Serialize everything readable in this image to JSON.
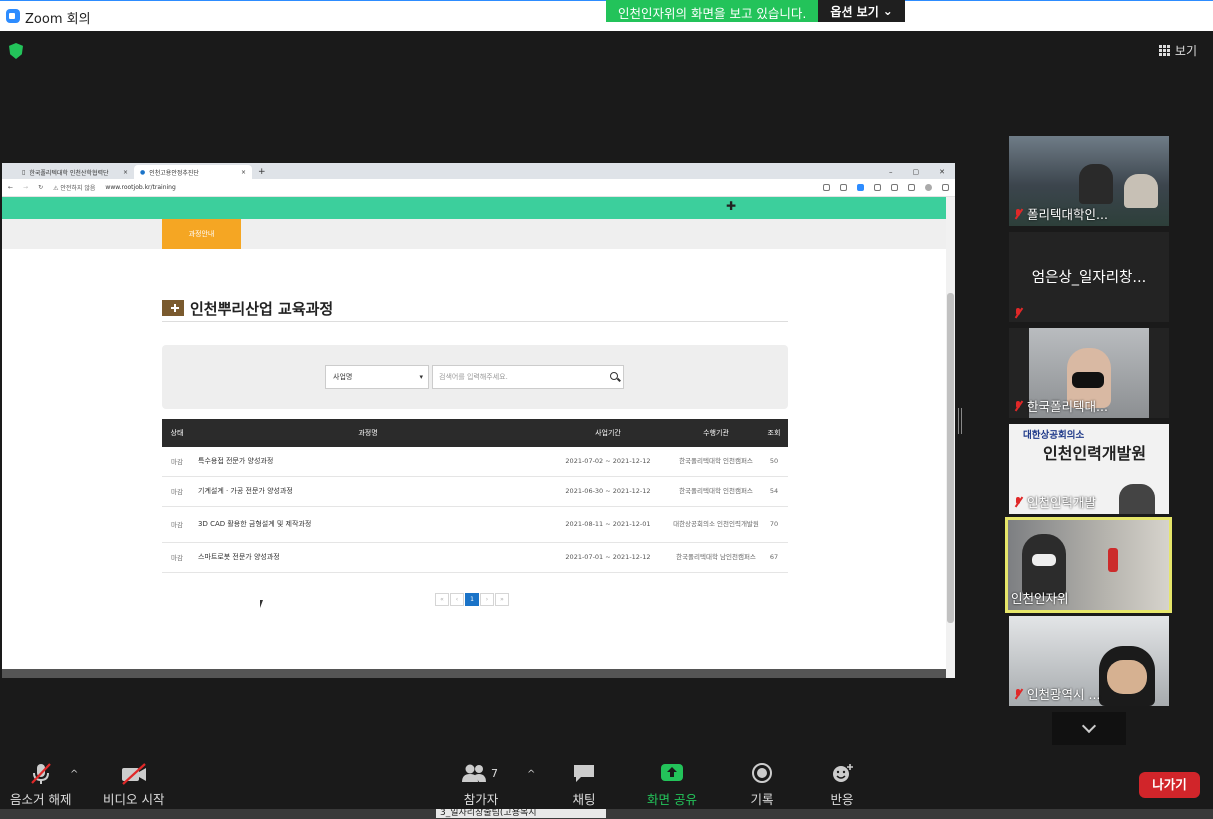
{
  "zoom": {
    "window_title": "Zoom 회의",
    "share_banner": "인천인자위의 화면을 보고 있습니다.",
    "options_label": "옵션 보기",
    "view_label": "보기"
  },
  "browser": {
    "tabs": [
      {
        "label": "한국폴리텍대학 인천산학협력단"
      },
      {
        "label": "인천고용안정추진단"
      }
    ],
    "security_text": "안전하지 않음",
    "url": "www.rootjob.kr/training"
  },
  "page": {
    "subnav_active": "과정안내",
    "title": "인천뿌리산업 교육과정",
    "search": {
      "select_value": "사업명",
      "placeholder": "검색어를 입력해주세요."
    },
    "table": {
      "headers": {
        "status": "상태",
        "name": "과정명",
        "period": "사업기간",
        "agency": "수행기관",
        "views": "조회"
      },
      "rows": [
        {
          "status": "마감",
          "name": "특수용접 전문가 양성과정",
          "period": "2021-07-02 ~ 2021-12-12",
          "agency": "한국폴리텍대학 인천캠퍼스",
          "views": "50"
        },
        {
          "status": "마감",
          "name": "기계설계 · 가공 전문가 양성과정",
          "period": "2021-06-30 ~ 2021-12-12",
          "agency": "한국폴리텍대학 인천캠퍼스",
          "views": "54"
        },
        {
          "status": "마감",
          "name": "3D CAD 활용한 금형설계 및 제작과정",
          "period": "2021-08-11 ~ 2021-12-01",
          "agency": "대한상공회의소 인천인력개발원",
          "views": "70"
        },
        {
          "status": "마감",
          "name": "스마트로봇 전문가 양성과정",
          "period": "2021-07-01 ~ 2021-12-12",
          "agency": "한국폴리텍대학 남인천캠퍼스",
          "views": "67"
        }
      ]
    },
    "pager": {
      "current": "1",
      "first": "«",
      "prev": "‹",
      "next": "›",
      "last": "»"
    }
  },
  "participants": [
    {
      "name": "폴리텍대학인..."
    },
    {
      "name": "엄은상_일자리창..."
    },
    {
      "name": "한국폴리텍대..."
    },
    {
      "name": "인천인력개발",
      "video_text_top": "대한상공회의소",
      "video_text_main": "인천인력개발원"
    },
    {
      "name": "인천인자위"
    },
    {
      "name": "인천광역시 ..."
    }
  ],
  "toolbar": {
    "unmute": "음소거 해제",
    "start_video": "비디오 시작",
    "participants": "참가자",
    "participant_count": "7",
    "chat": "채팅",
    "share_screen": "화면 공유",
    "record": "기록",
    "reactions": "반응",
    "leave": "나가기"
  },
  "taskbar": {
    "item2": "3_일자리창출팀(고용복지"
  },
  "colors": {
    "zoom_green": "#23c35a",
    "leave_red": "#d1252a",
    "teal": "#3ccf9c",
    "orange": "#f5a623",
    "active_speaker": "#e6e66a"
  }
}
